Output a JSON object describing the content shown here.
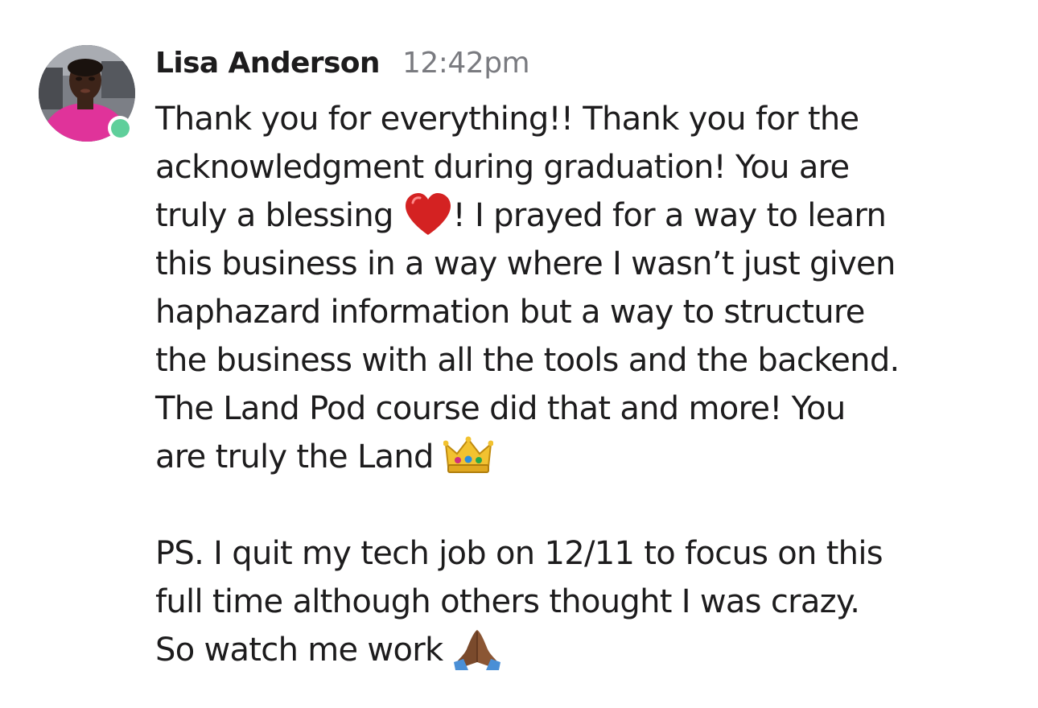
{
  "message": {
    "sender": "Lisa Anderson",
    "timestamp": "12:42pm",
    "presence_status": "online",
    "presence_color": "#5fcf9b",
    "avatar_icon": "user-photo-avatar",
    "lines": [
      "Thank you for everything!! Thank you for the",
      "acknowledgment during graduation! You are",
      "truly a blessing ",
      "! I prayed for a way to learn",
      "this business in a way where I wasn’t just given",
      "haphazard information but a way to structure",
      "the business with all the tools and the backend.",
      "The Land Pod course did that and more! You",
      "are truly the Land ",
      "PS.  I quit my tech job on 12/11 to focus on this",
      "full time although others thought I was crazy.",
      "So watch me work "
    ],
    "emojis": {
      "heart": "red-heart-icon",
      "crown": "crown-icon",
      "pray": "folded-hands-icon"
    }
  }
}
